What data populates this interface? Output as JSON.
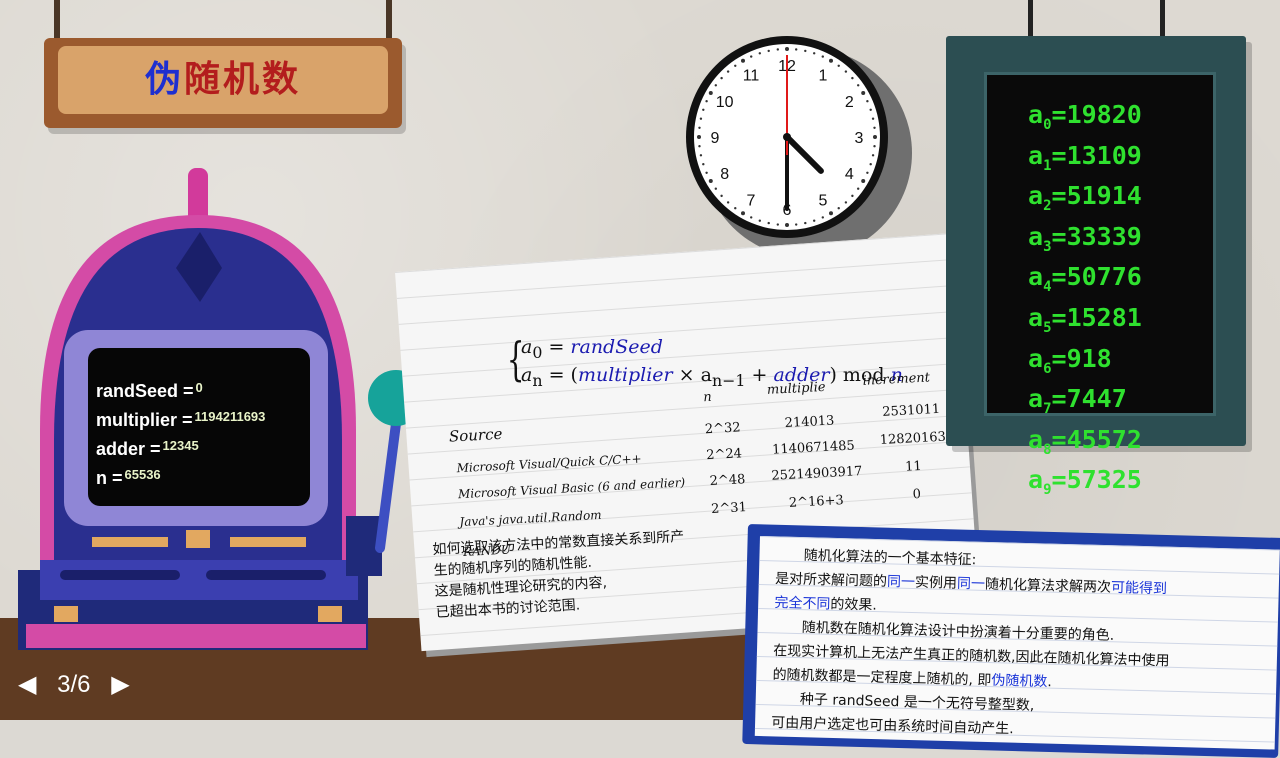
{
  "title": {
    "first_char": "伪",
    "rest": "随机数"
  },
  "clock": {
    "numbers": [
      "12",
      "1",
      "2",
      "3",
      "4",
      "5",
      "6",
      "7",
      "8",
      "9",
      "10",
      "11"
    ],
    "hour_value": 4.5,
    "minute_value": 30,
    "second_value": 0
  },
  "machine": {
    "params": [
      {
        "label": "randSeed =",
        "value": "0"
      },
      {
        "label": "multiplier =",
        "value": "1194211693"
      },
      {
        "label": "adder =",
        "value": "12345"
      },
      {
        "label": "n =",
        "value": "65536"
      }
    ]
  },
  "formula": {
    "line1_a": "a",
    "line1_sub": "0",
    "line1_eq": " = ",
    "line1_var": "randSeed",
    "line2_a": "a",
    "line2_sub": "n",
    "line2_eq": " = (",
    "line2_mult": "multiplier",
    "line2_times": " × a",
    "line2_sub2": "n−1",
    "line2_plus": " + ",
    "line2_adder": "adder",
    "line2_close": ") mod ",
    "line2_n": "n"
  },
  "lcg_table": {
    "headers": {
      "source": "Source",
      "n": "n",
      "multiplier": "multiplie",
      "increment": "increment"
    },
    "rows": [
      {
        "source": "Microsoft Visual/Quick C/C++",
        "n": "2^32",
        "multiplier": "214013",
        "increment": "2531011"
      },
      {
        "source": "Microsoft Visual Basic (6 and earlier)",
        "n": "2^24",
        "multiplier": "1140671485",
        "increment": "12820163"
      },
      {
        "source": "Java's java.util.Random",
        "n": "2^48",
        "multiplier": "25214903917",
        "increment": "11"
      },
      {
        "source": "RANDU",
        "n": "2^31",
        "multiplier": "2^16+3",
        "increment": "0"
      }
    ]
  },
  "paper_note": [
    "如何选取该方法中的常数直接关系到所产",
    "生的随机序列的随机性能.",
    "这是随机性理论研究的内容,",
    "已超出本书的讨论范围."
  ],
  "sequence": [
    {
      "sub": "0",
      "value": "19820"
    },
    {
      "sub": "1",
      "value": "13109"
    },
    {
      "sub": "2",
      "value": "51914"
    },
    {
      "sub": "3",
      "value": "33339"
    },
    {
      "sub": "4",
      "value": "50776"
    },
    {
      "sub": "5",
      "value": "15281"
    },
    {
      "sub": "6",
      "value": "918"
    },
    {
      "sub": "7",
      "value": "7447"
    },
    {
      "sub": "8",
      "value": "45572"
    },
    {
      "sub": "9",
      "value": "57325"
    }
  ],
  "note": {
    "l1": "随机化算法的一个基本特征:",
    "l2_a": "是对所求解问题的",
    "l2_b": "同一",
    "l2_c": "实例用",
    "l2_d": "同一",
    "l2_e": "随机化算法求解两次",
    "l2_f": "可能得到",
    "l3_a": "完全不同",
    "l3_b": "的效果.",
    "l4": "随机数在随机化算法设计中扮演着十分重要的角色.",
    "l5": "在现实计算机上无法产生真正的随机数,因此在随机化算法中使用",
    "l6_a": "的随机数都是一定程度上随机的, 即",
    "l6_b": "伪随机数",
    "l6_c": ".",
    "l7": "种子 randSeed 是一个无符号整型数,",
    "l8": "可由用户选定也可由系统时间自动产生."
  },
  "pager": {
    "prev": "◀",
    "label": "3/6",
    "next": "▶"
  },
  "colors": {
    "accent_blue": "#1b35d8",
    "title_red": "#b31d1d",
    "seq_green": "#2fe12f"
  }
}
